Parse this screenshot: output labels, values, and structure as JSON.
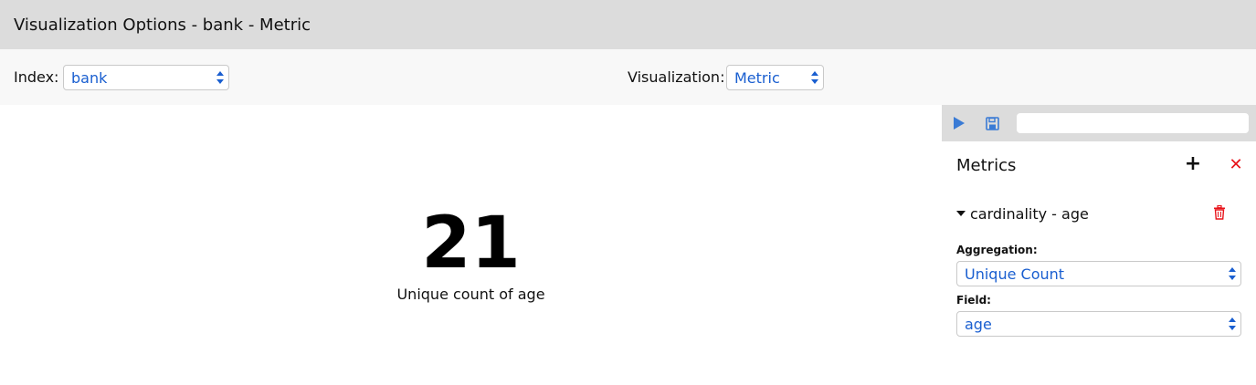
{
  "window": {
    "title": "Visualization Options - bank - Metric"
  },
  "options": {
    "index_label": "Index:",
    "index_value": "bank",
    "visualization_label": "Visualization:",
    "visualization_value": "Metric"
  },
  "metric": {
    "value": "21",
    "label": "Unique count of age"
  },
  "sidebar": {
    "toolbar": {
      "run_icon": "play-icon",
      "save_icon": "floppy-disk-icon",
      "search_value": ""
    },
    "metrics_title": "Metrics",
    "add_icon": "plus-icon",
    "close_icon": "close-icon",
    "aggregation": {
      "title": "cardinality - age",
      "delete_icon": "trash-icon",
      "aggregation_label": "Aggregation:",
      "aggregation_value": "Unique Count",
      "field_label": "Field:",
      "field_value": "age"
    }
  },
  "colors": {
    "accent_blue": "#1a5fd0",
    "danger_red": "#e8131a",
    "titlebar_bg": "#dcdcdc"
  }
}
